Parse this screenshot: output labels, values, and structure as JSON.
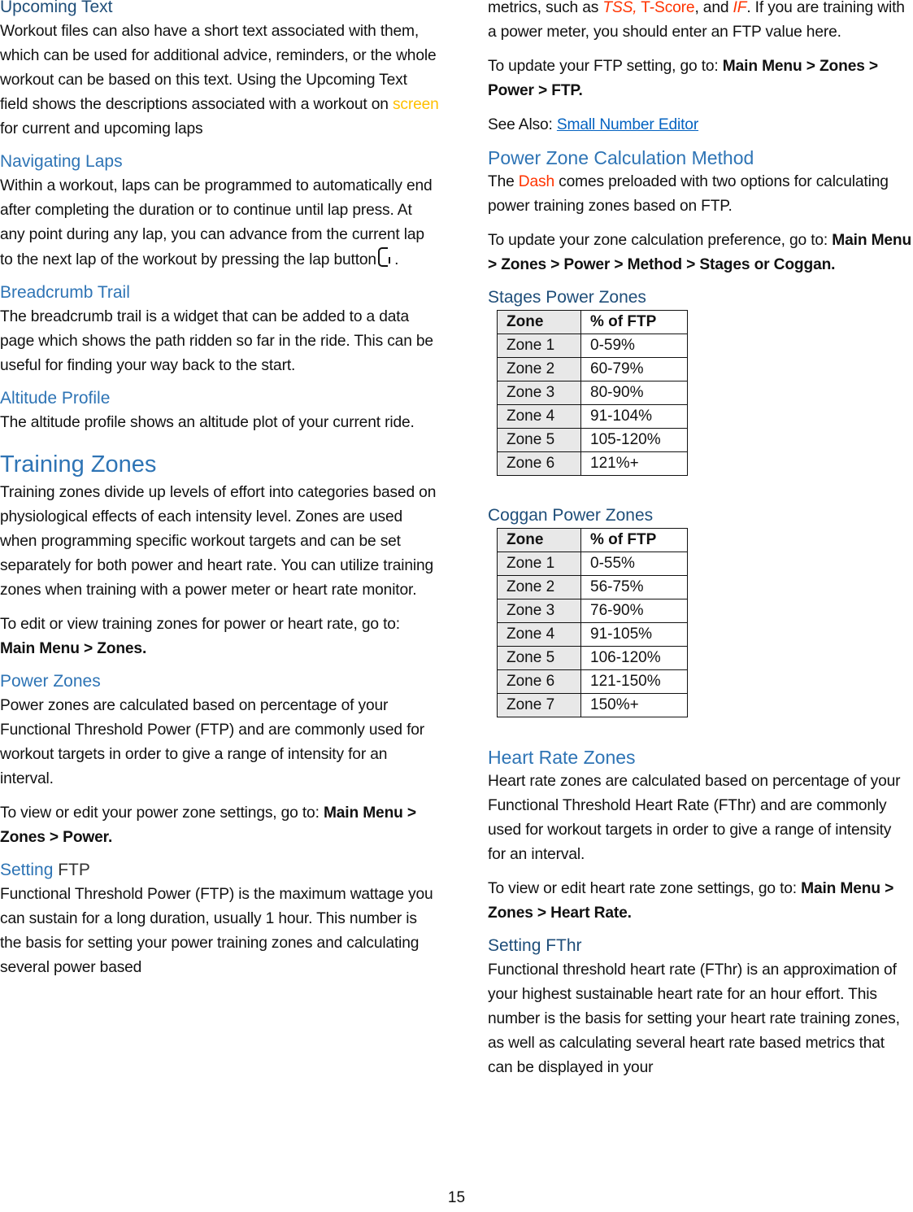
{
  "page_number": "15",
  "colors": {
    "heading_blue": "#2e74b5",
    "subheading_blue": "#1f4e79",
    "highlight_orange": "#ffc000",
    "highlight_red": "#ff3300",
    "link_blue": "#0563c1",
    "table_zone_bg": "#e8e8e8"
  },
  "left": {
    "upcoming_text": {
      "heading": "Upcoming Text",
      "body_pre": "Workout files can also have a short text associated with them, which can be used for additional advice, reminders, or the whole workout can be based on this text. Using the Upcoming Text field shows the descriptions associated with a workout on ",
      "body_highlight": "screen",
      "body_post": " for current and upcoming laps"
    },
    "navigating_laps": {
      "heading": "Navigating Laps",
      "body_pre": "Within a workout, laps can be programmed to automatically end after completing the duration or to continue until lap press. At any point during any lap, you can advance from the current lap to the next lap of the workout by pressing the lap button",
      "icon": "lap-button-icon",
      "body_post": " ."
    },
    "breadcrumb_trail": {
      "heading": "Breadcrumb Trail",
      "body": "The breadcrumb trail is a widget that can be added to a data page which shows the path ridden so far in the ride. This can be useful for finding your way back to the start."
    },
    "altitude_profile": {
      "heading": "Altitude Profile",
      "body": "The altitude profile shows an altitude plot of your current ride."
    },
    "training_zones": {
      "heading": "Training Zones",
      "body": "Training zones divide up levels of effort into categories based on physiological effects of each intensity level. Zones are used when programming specific workout targets and can be set separately for both power and heart rate. You can utilize training zones when training with a power meter or heart rate monitor.",
      "nav_pre": "To edit or view training zones for power or heart rate, go to: ",
      "nav_path": "Main Menu > Zones."
    },
    "power_zones": {
      "heading": "Power Zones",
      "body": "Power zones are calculated based on percentage of your Functional Threshold Power (FTP) and are commonly used for workout targets in order to give a range of intensity for an interval.",
      "nav_pre": "To view or edit your power zone settings, go to: ",
      "nav_path": "Main Menu > Zones > Power."
    },
    "setting_ftp": {
      "heading_part1": "Setting",
      "heading_part2": " FTP",
      "body": "Functional Threshold Power (FTP) is the maximum wattage you can sustain for a long duration, usually 1 hour. This number is the basis for setting your power training zones and calculating several power based"
    }
  },
  "right": {
    "ftp_continued": {
      "body_pre": "metrics, such as ",
      "tss": "TSS,",
      "tscore": " T-Score",
      "mid": ", and ",
      "if": "IF",
      "body_post": ". If you are training with a power meter, you should enter an FTP value here.",
      "nav_pre": "To update your FTP setting, go to: ",
      "nav_path": "Main Menu > Zones > Power > FTP.",
      "see_also_label": "See Also: ",
      "see_also_link": "Small Number Editor"
    },
    "calc_method": {
      "heading": "Power Zone Calculation Method",
      "body_pre": "The ",
      "body_highlight": "Dash",
      "body_post": " comes preloaded with two options for calculating power training zones based on FTP.",
      "nav_pre": "To update your zone calculation preference, go to: ",
      "nav_path": "Main Menu > Zones > Power > Method > Stages or Coggan."
    },
    "stages_zones": {
      "heading": "Stages Power Zones",
      "columns": [
        "Zone",
        "% of FTP"
      ],
      "rows": [
        [
          "Zone 1",
          "0-59%"
        ],
        [
          "Zone 2",
          "60-79%"
        ],
        [
          "Zone 3",
          "80-90%"
        ],
        [
          "Zone 4",
          "91-104%"
        ],
        [
          "Zone 5",
          "105-120%"
        ],
        [
          "Zone 6",
          "121%+"
        ]
      ]
    },
    "coggan_zones": {
      "heading": "Coggan Power Zones",
      "columns": [
        "Zone",
        "% of FTP"
      ],
      "rows": [
        [
          "Zone 1",
          "0-55%"
        ],
        [
          "Zone 2",
          "56-75%"
        ],
        [
          "Zone 3",
          "76-90%"
        ],
        [
          "Zone 4",
          "91-105%"
        ],
        [
          "Zone 5",
          "106-120%"
        ],
        [
          "Zone 6",
          "121-150%"
        ],
        [
          "Zone 7",
          "150%+"
        ]
      ]
    },
    "heart_rate_zones": {
      "heading": "Heart Rate Zones",
      "body": "Heart rate zones are calculated based on percentage of your Functional Threshold Heart Rate (FThr) and are commonly used for workout targets in order to give a range of intensity for an interval.",
      "nav_pre": "To view or edit heart rate zone settings, go to: ",
      "nav_path": "Main Menu > Zones > Heart Rate."
    },
    "setting_fthr": {
      "heading": "Setting FThr",
      "body": "Functional threshold heart rate (FThr) is an approximation of your highest sustainable heart rate for an hour effort. This number is the basis for setting your heart rate training zones, as well as calculating several heart rate based metrics that can be displayed in your"
    }
  }
}
